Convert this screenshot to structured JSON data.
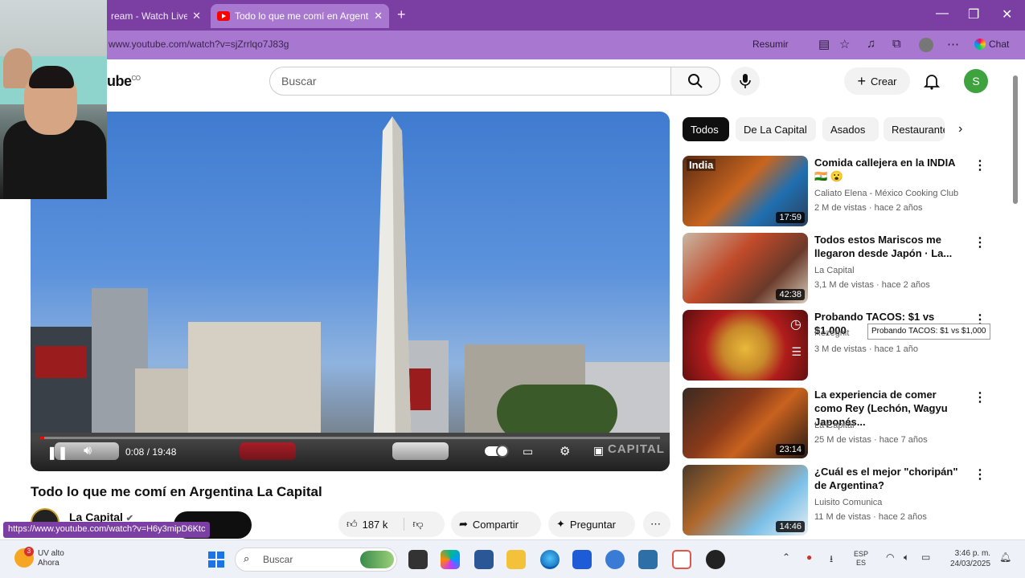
{
  "browser": {
    "tabs": [
      {
        "title": "ream - Watch Live o"
      },
      {
        "title": "Todo lo que me comí en Argentina"
      }
    ],
    "url": "www.youtube.com/watch?v=sjZrrlqo7J83g",
    "resumir": "Resumir",
    "chat": "Chat"
  },
  "youtube": {
    "logo": "ube",
    "country": "CO",
    "search_placeholder": "Buscar",
    "create_label": "Crear",
    "avatar_letter": "S"
  },
  "player": {
    "time": "0:08 / 19:48",
    "progress": 0.007,
    "watermark": "CAPITAL"
  },
  "video": {
    "title": "Todo lo que me comí en Argentina   La Capital",
    "channel": "La Capital",
    "likes": "187 k",
    "share": "Compartir",
    "ask": "Preguntar"
  },
  "chips": [
    "Todos",
    "De La Capital",
    "Asados",
    "Restaurantes"
  ],
  "recommendations": [
    {
      "title": "Comida callejera en la INDIA",
      "title2": "🇮🇳 😮",
      "channel": "Caliato Elena - México Cooking Club",
      "meta": "2 M de vistas · hace 2 años",
      "duration": "17:59",
      "thumb_label": "India"
    },
    {
      "title": "Todos estos Mariscos me llegaron desde Japón · La...",
      "channel": "La Capital",
      "meta": "3,1 M de vistas · hace 2 años",
      "duration": "42:38"
    },
    {
      "title": "Probando TACOS: $1 vs $1,000",
      "channel": "Rezegnit",
      "meta": "3 M de vistas · hace 1 año",
      "duration": ""
    },
    {
      "title": "La experiencia de comer como Rey (Lechón, Wagyu Japonés...",
      "channel": "La Capital",
      "meta": "25 M de vistas · hace 7 años",
      "duration": "23:14"
    },
    {
      "title": "¿Cuál es el mejor \"choripán\" de Argentina?",
      "channel": "Luisito Comunica",
      "meta": "11 M de vistas · hace 2 años",
      "duration": "14:46"
    }
  ],
  "tooltip": "Probando TACOS: $1 vs $1,000",
  "status_url": "https://www.youtube.com/watch?v=H6y3mipD6Ktc",
  "taskbar": {
    "weather_temp": "UV alto",
    "weather_sub": "Ahora",
    "weather_badge": "3",
    "search": "Buscar",
    "lang1": "ESP",
    "lang2": "ES",
    "time": "3:46 p. m.",
    "date": "24/03/2025"
  }
}
